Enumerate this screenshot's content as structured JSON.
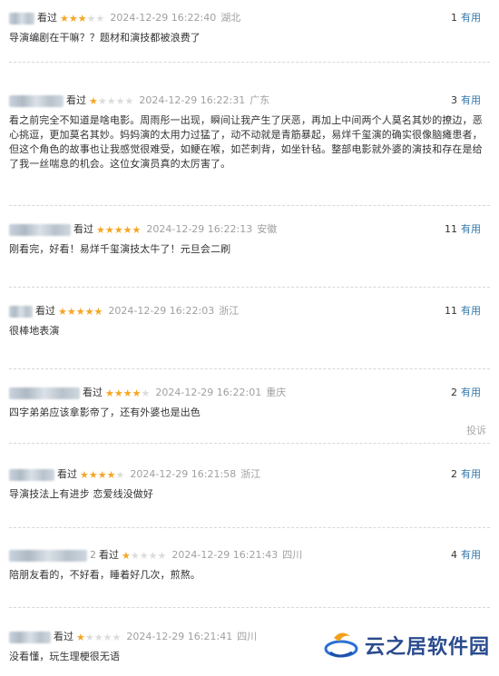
{
  "colors": {
    "star_on": "#f5a623",
    "star_off": "#dcdcdc",
    "link": "#3377aa",
    "meta": "#a0a0a0"
  },
  "watched_label": "看过",
  "useful_label": "有用",
  "report_label": "投诉",
  "watermark": "云之居软件园",
  "reviews": [
    {
      "user_suffix": "",
      "rating": 3,
      "time": "2024-12-29 16:22:40",
      "location": "湖北",
      "useful": "1",
      "content": "导演编剧在干嘛？？题材和演技都被浪费了"
    },
    {
      "user_suffix": "",
      "rating": 1,
      "time": "2024-12-29 16:22:31",
      "location": "广东",
      "useful": "3",
      "content": "看之前完全不知道是啥电影。周雨彤一出现，瞬间让我产生了厌恶，再加上中间两个人莫名其妙的撩边，恶心挑逗，更加莫名其妙。妈妈演的太用力过猛了，动不动就是青筋暴起，易烊千玺演的确实很像脑瘫患者，但这个角色的故事也让我感觉很难受，如鲠在喉，如芒刺背，如坐针毡。整部电影就外婆的演技和存在是给了我一丝喘息的机会。这位女演员真的太厉害了。"
    },
    {
      "user_suffix": "",
      "rating": 5,
      "time": "2024-12-29 16:22:13",
      "location": "安徽",
      "useful": "11",
      "content": "刚看完，好看！易烊千玺演技太牛了！元旦会二刷"
    },
    {
      "user_suffix": "",
      "rating": 5,
      "time": "2024-12-29 16:22:03",
      "location": "浙江",
      "useful": "11",
      "content": "很棒地表演"
    },
    {
      "user_suffix": "",
      "rating": 4,
      "time": "2024-12-29 16:22:01",
      "location": "重庆",
      "useful": "2",
      "content": "四字弟弟应该拿影帝了，还有外婆也是出色"
    },
    {
      "user_suffix": "",
      "rating": 4,
      "time": "2024-12-29 16:21:58",
      "location": "浙江",
      "useful": "2",
      "content": "导演技法上有进步 恋爱线没做好"
    },
    {
      "user_suffix": "2",
      "rating": 1,
      "time": "2024-12-29 16:21:43",
      "location": "四川",
      "useful": "4",
      "content": "陪朋友看的，不好看，睡着好几次，煎熬。"
    },
    {
      "user_suffix": "",
      "rating": 1,
      "time": "2024-12-29 16:21:41",
      "location": "四川",
      "useful": "",
      "content": "没看懂，玩生理梗很无语"
    }
  ]
}
